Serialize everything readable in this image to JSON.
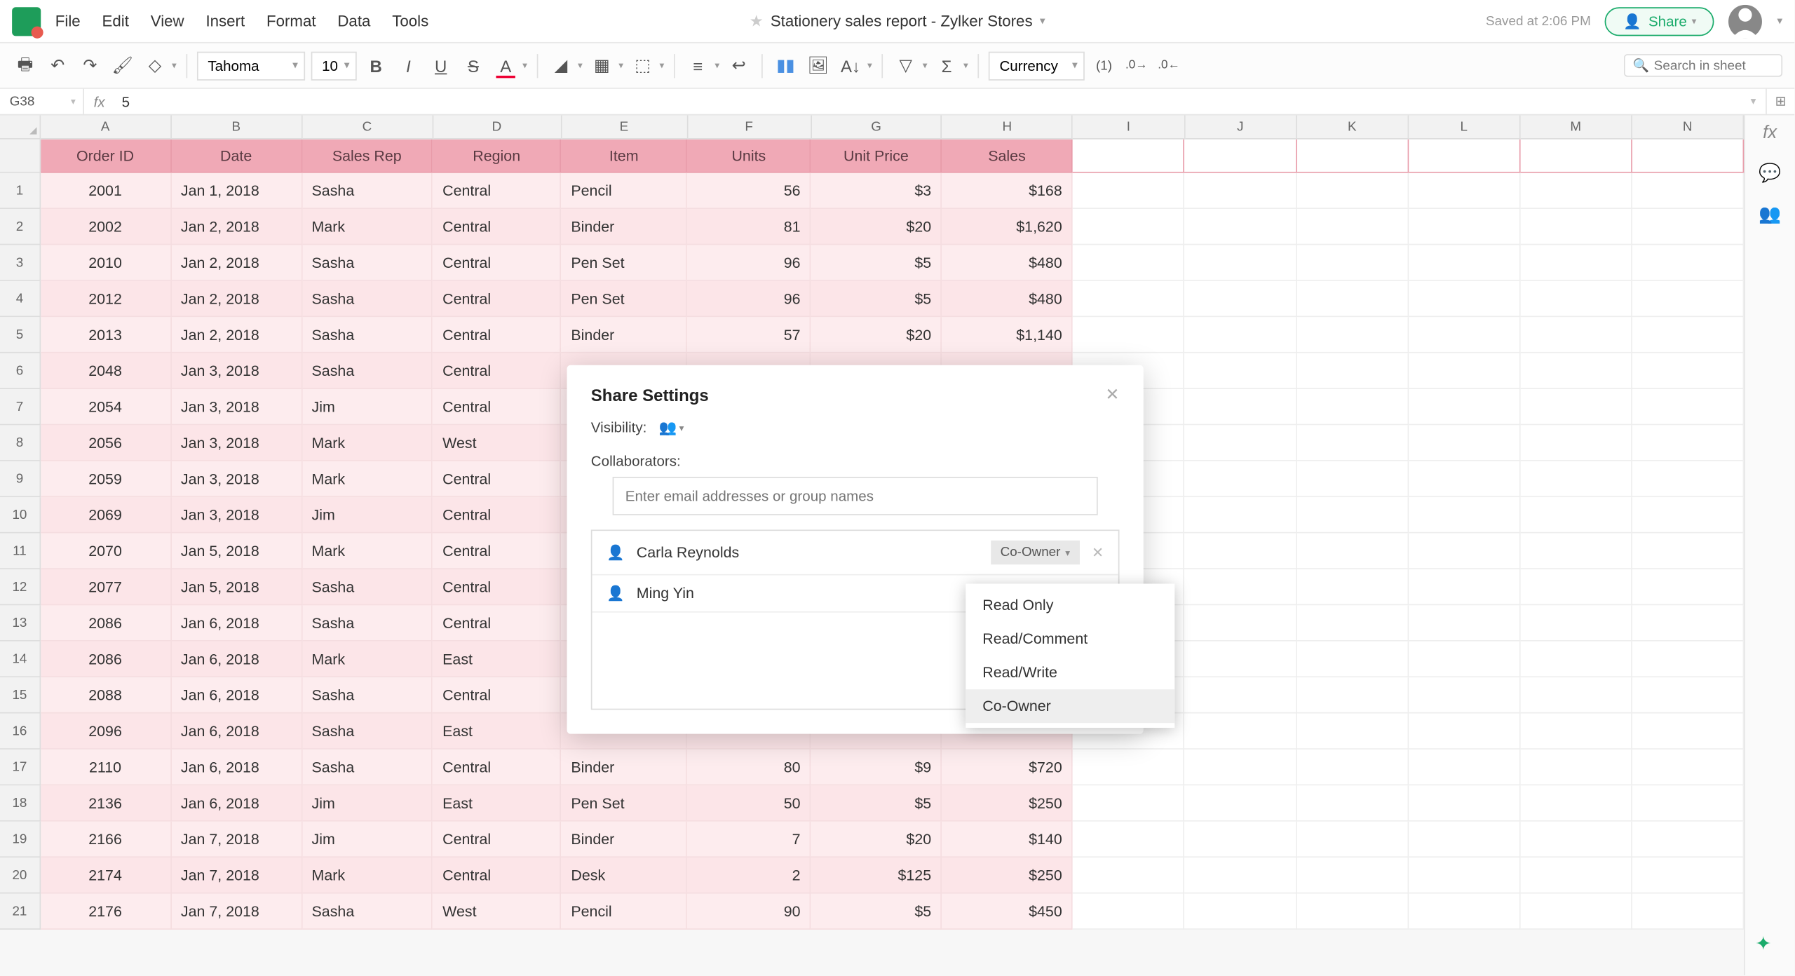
{
  "document_title": "Stationery sales report - Zylker Stores",
  "saved_text": "Saved at 2:06 PM",
  "share_button": "Share",
  "menus": [
    "File",
    "Edit",
    "View",
    "Insert",
    "Format",
    "Data",
    "Tools"
  ],
  "toolbar": {
    "font": "Tahoma",
    "size": "10",
    "format": "Currency",
    "search_placeholder": "Search in sheet"
  },
  "cell_ref": "G38",
  "formula_value": "5",
  "columns": [
    "A",
    "B",
    "C",
    "D",
    "E",
    "F",
    "G",
    "H",
    "I",
    "J",
    "K",
    "L",
    "M",
    "N"
  ],
  "headers": [
    "Order ID",
    "Date",
    "Sales Rep",
    "Region",
    "Item",
    "Units",
    "Unit Price",
    "Sales"
  ],
  "rows": [
    {
      "n": 1,
      "a": "2001",
      "b": "Jan 1, 2018",
      "c": "Sasha",
      "d": "Central",
      "e": "Pencil",
      "f": "56",
      "g": "$3",
      "h": "$168"
    },
    {
      "n": 2,
      "a": "2002",
      "b": "Jan 2, 2018",
      "c": "Mark",
      "d": "Central",
      "e": "Binder",
      "f": "81",
      "g": "$20",
      "h": "$1,620"
    },
    {
      "n": 3,
      "a": "2010",
      "b": "Jan 2, 2018",
      "c": "Sasha",
      "d": "Central",
      "e": "Pen Set",
      "f": "96",
      "g": "$5",
      "h": "$480"
    },
    {
      "n": 4,
      "a": "2012",
      "b": "Jan 2, 2018",
      "c": "Sasha",
      "d": "Central",
      "e": "Pen Set",
      "f": "96",
      "g": "$5",
      "h": "$480"
    },
    {
      "n": 5,
      "a": "2013",
      "b": "Jan 2, 2018",
      "c": "Sasha",
      "d": "Central",
      "e": "Binder",
      "f": "57",
      "g": "$20",
      "h": "$1,140"
    },
    {
      "n": 6,
      "a": "2048",
      "b": "Jan 3, 2018",
      "c": "Sasha",
      "d": "Central",
      "e": "",
      "f": "",
      "g": "",
      "h": ""
    },
    {
      "n": 7,
      "a": "2054",
      "b": "Jan 3, 2018",
      "c": "Jim",
      "d": "Central",
      "e": "",
      "f": "",
      "g": "",
      "h": ""
    },
    {
      "n": 8,
      "a": "2056",
      "b": "Jan 3, 2018",
      "c": "Mark",
      "d": "West",
      "e": "",
      "f": "",
      "g": "",
      "h": ""
    },
    {
      "n": 9,
      "a": "2059",
      "b": "Jan 3, 2018",
      "c": "Mark",
      "d": "Central",
      "e": "",
      "f": "",
      "g": "",
      "h": ""
    },
    {
      "n": 10,
      "a": "2069",
      "b": "Jan 3, 2018",
      "c": "Jim",
      "d": "Central",
      "e": "",
      "f": "",
      "g": "",
      "h": ""
    },
    {
      "n": 11,
      "a": "2070",
      "b": "Jan 5, 2018",
      "c": "Mark",
      "d": "Central",
      "e": "",
      "f": "",
      "g": "",
      "h": ""
    },
    {
      "n": 12,
      "a": "2077",
      "b": "Jan 5, 2018",
      "c": "Sasha",
      "d": "Central",
      "e": "",
      "f": "",
      "g": "",
      "h": ""
    },
    {
      "n": 13,
      "a": "2086",
      "b": "Jan 6, 2018",
      "c": "Sasha",
      "d": "Central",
      "e": "",
      "f": "",
      "g": "",
      "h": ""
    },
    {
      "n": 14,
      "a": "2086",
      "b": "Jan 6, 2018",
      "c": "Mark",
      "d": "East",
      "e": "",
      "f": "",
      "g": "",
      "h": ""
    },
    {
      "n": 15,
      "a": "2088",
      "b": "Jan 6, 2018",
      "c": "Sasha",
      "d": "Central",
      "e": "",
      "f": "",
      "g": "",
      "h": ""
    },
    {
      "n": 16,
      "a": "2096",
      "b": "Jan 6, 2018",
      "c": "Sasha",
      "d": "East",
      "e": "",
      "f": "",
      "g": "",
      "h": ""
    },
    {
      "n": 17,
      "a": "2110",
      "b": "Jan 6, 2018",
      "c": "Sasha",
      "d": "Central",
      "e": "Binder",
      "f": "80",
      "g": "$9",
      "h": "$720"
    },
    {
      "n": 18,
      "a": "2136",
      "b": "Jan 6, 2018",
      "c": "Jim",
      "d": "East",
      "e": "Pen Set",
      "f": "50",
      "g": "$5",
      "h": "$250"
    },
    {
      "n": 19,
      "a": "2166",
      "b": "Jan 7, 2018",
      "c": "Jim",
      "d": "Central",
      "e": "Binder",
      "f": "7",
      "g": "$20",
      "h": "$140"
    },
    {
      "n": 20,
      "a": "2174",
      "b": "Jan 7, 2018",
      "c": "Mark",
      "d": "Central",
      "e": "Desk",
      "f": "2",
      "g": "$125",
      "h": "$250"
    },
    {
      "n": 21,
      "a": "2176",
      "b": "Jan 7, 2018",
      "c": "Sasha",
      "d": "West",
      "e": "Pencil",
      "f": "90",
      "g": "$5",
      "h": "$450"
    }
  ],
  "dialog": {
    "title": "Share Settings",
    "visibility_label": "Visibility:",
    "collaborators_label": "Collaborators:",
    "input_placeholder": "Enter email addresses or group names",
    "people": [
      {
        "name": "Carla Reynolds",
        "role": "Co-Owner",
        "show_role": true
      },
      {
        "name": "Ming Yin",
        "role": "",
        "show_role": false
      }
    ],
    "options": [
      "Read Only",
      "Read/Comment",
      "Read/Write",
      "Co-Owner"
    ]
  }
}
